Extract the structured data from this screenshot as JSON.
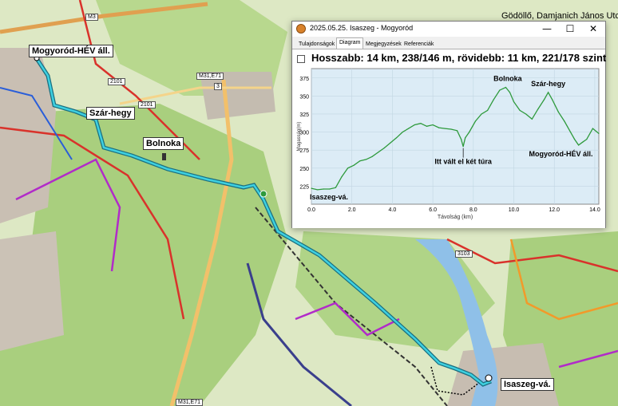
{
  "map": {
    "labels": {
      "mogyorod_hev": "Mogyoród-HÉV áll.",
      "szar_hegy": "Szár-hegy",
      "bolnoka": "Bolnoka",
      "isaszeg": "Isaszeg-vá."
    },
    "roads": {
      "m3": "M3",
      "r2101": "2101",
      "r2101b": "2101",
      "m31": "M31,E71",
      "r3": "3",
      "r3103": "3103",
      "m31b": "M31,E71"
    },
    "top_right_stop": "Gödöllő, Damjanich János Utca",
    "colors": {
      "track": "#20b8c8",
      "forest": "#a9cf7e",
      "field": "#dde8c4",
      "urban": "#c9bfb3",
      "red_trail": "#d9322b",
      "purple_trail": "#b12bc9",
      "water": "#8fc0e8"
    }
  },
  "window": {
    "title": "2025.05.25. Isaszeg - Mogyoród",
    "min_glyph": "—",
    "max_glyph": "☐",
    "close_glyph": "✕",
    "tabs": [
      "Tulajdonságok",
      "Diagram",
      "Megjegyzések",
      "Referenciák"
    ],
    "active_tab": 1,
    "headline": "Hosszabb: 14 km, 238/146 m, rövidebb: 11 km, 221/178 szint"
  },
  "chart_data": {
    "type": "line",
    "xlabel": "Távolság (km)",
    "ylabel": "Magasság(m)",
    "xlim": [
      0,
      14.2
    ],
    "ylim": [
      200,
      388
    ],
    "x_ticks": [
      0.0,
      2.0,
      4.0,
      6.0,
      8.0,
      10.0,
      12.0,
      14.0
    ],
    "y_ticks": [
      225,
      250,
      275,
      300,
      325,
      350,
      375
    ],
    "grid": true,
    "line_color": "#2e9a3c",
    "background_color": "#dcecf6",
    "series": [
      {
        "x": [
          0,
          0.3,
          0.6,
          0.9,
          1.2,
          1.5,
          1.8,
          2.1,
          2.4,
          2.7,
          3.0,
          3.3,
          3.6,
          3.9,
          4.2,
          4.5,
          4.8,
          5.1,
          5.4,
          5.7,
          6.0,
          6.3,
          6.6,
          6.9,
          7.2,
          7.4,
          7.5,
          7.6,
          7.8,
          8.1,
          8.4,
          8.7,
          9.0,
          9.3,
          9.6,
          9.8,
          10.0,
          10.3,
          10.6,
          10.9,
          11.2,
          11.5,
          11.7,
          11.9,
          12.2,
          12.5,
          12.8,
          13.0,
          13.2,
          13.4,
          13.6,
          13.9,
          14.2
        ],
        "y": [
          222,
          220,
          221,
          221,
          223,
          238,
          250,
          254,
          260,
          262,
          266,
          272,
          278,
          285,
          292,
          300,
          305,
          310,
          312,
          308,
          310,
          306,
          305,
          304,
          302,
          290,
          280,
          292,
          300,
          315,
          325,
          330,
          345,
          358,
          362,
          355,
          342,
          330,
          325,
          318,
          332,
          345,
          355,
          345,
          328,
          315,
          300,
          290,
          282,
          286,
          290,
          305,
          298
        ]
      }
    ],
    "annotations": [
      {
        "text": "Bolnoka",
        "x": 9.7,
        "y": 362
      },
      {
        "text": "Szár-hegy",
        "x": 11.7,
        "y": 355
      },
      {
        "text": "Itt vált el két túra",
        "x": 7.5,
        "y": 280
      },
      {
        "text": "Mogyoród-HÉV áll.",
        "x": 12.8,
        "y": 282
      },
      {
        "text": "Isaszeg-vá.",
        "x": 0,
        "y": 222
      }
    ]
  }
}
